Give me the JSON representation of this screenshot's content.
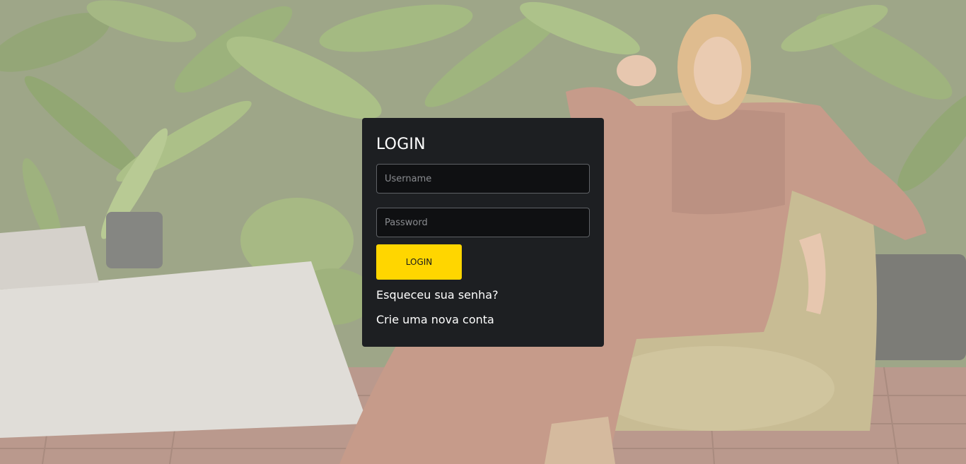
{
  "login": {
    "title": "LOGIN",
    "username_placeholder": "Username",
    "password_placeholder": "Password",
    "submit_label": "LOGIN",
    "forgot_password": "Esqueceu sua senha?",
    "create_account": "Crie uma nova conta"
  },
  "colors": {
    "card_background": "#1d1f22",
    "accent": "#ffd600",
    "input_background": "#0f1012"
  }
}
